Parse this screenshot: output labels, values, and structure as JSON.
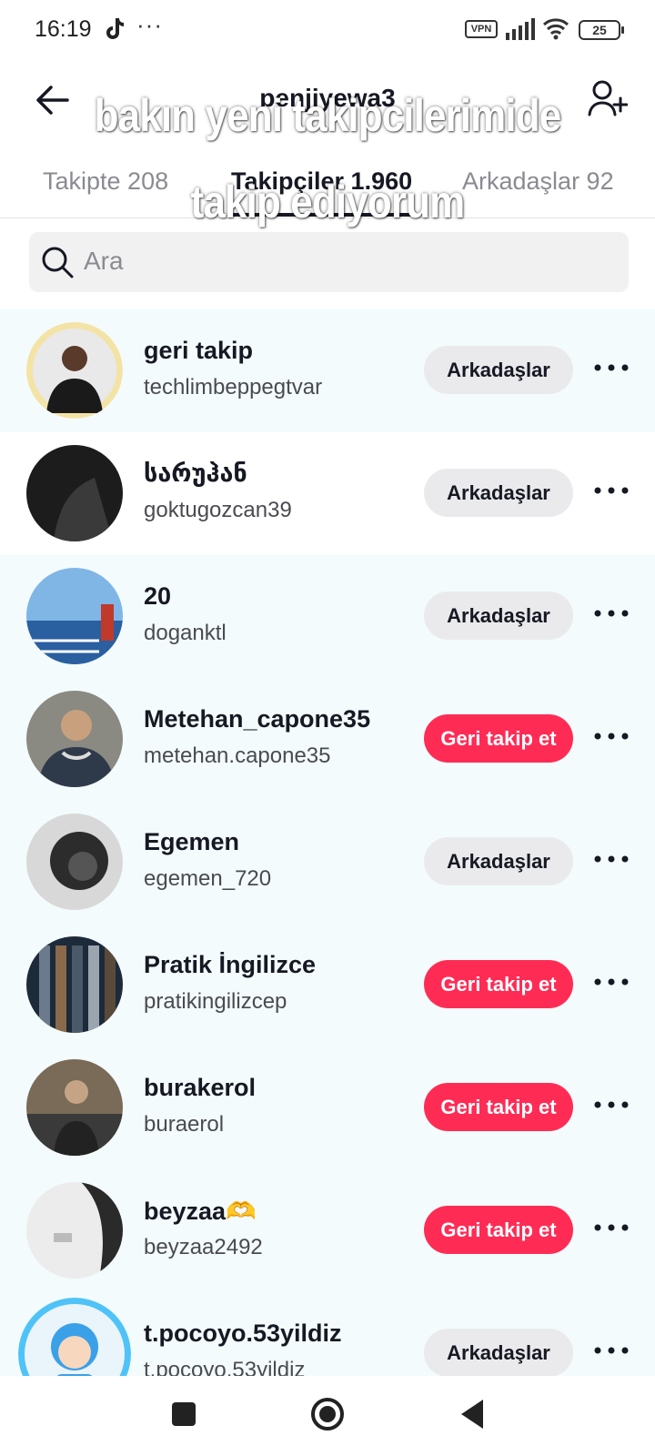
{
  "status_bar": {
    "time": "16:19",
    "dots": "···",
    "vpn": "VPN",
    "battery": "25"
  },
  "header": {
    "username": "penjiyewa3"
  },
  "overlay_caption": {
    "line1": "bakın yeni takipcilerimide",
    "line2": "takip ediyorum"
  },
  "tabs": {
    "following": "Takipte 208",
    "followers": "Takipçiler 1.960",
    "friends": "Arkadaşlar 92"
  },
  "search": {
    "placeholder": "Ara"
  },
  "colors": {
    "accent": "#fe2c55",
    "friends_button_bg": "#eaeaec",
    "list_bg": "#f3fbfc"
  },
  "followers": [
    {
      "name": "geri takip",
      "handle": "techlimbeppegtvar",
      "button": "Arkadaşlar",
      "button_type": "friends"
    },
    {
      "name": "სარუჰან",
      "handle": "goktugozcan39",
      "button": "Arkadaşlar",
      "button_type": "friends"
    },
    {
      "name": "20",
      "handle": "doganktl",
      "button": "Arkadaşlar",
      "button_type": "friends"
    },
    {
      "name": "Metehan_capone35",
      "handle": "metehan.capone35",
      "button": "Geri takip et",
      "button_type": "followback"
    },
    {
      "name": "Egemen",
      "handle": "egemen_720",
      "button": "Arkadaşlar",
      "button_type": "friends"
    },
    {
      "name": "Pratik İngilizce",
      "handle": "pratikingilizcep",
      "button": "Geri takip et",
      "button_type": "followback"
    },
    {
      "name": "burakerol",
      "handle": "buraerol",
      "button": "Geri takip et",
      "button_type": "followback"
    },
    {
      "name": "beyzaa🫶",
      "handle": "beyzaa2492",
      "button": "Geri takip et",
      "button_type": "followback"
    },
    {
      "name": "t.pocoyo.53yildiz",
      "handle": "t.pocoyo.53yildiz",
      "button": "Arkadaşlar",
      "button_type": "friends"
    }
  ],
  "icons": {
    "back": "arrow-left-icon",
    "add_user": "add-user-icon",
    "search": "search-icon",
    "more": "more-horizontal-icon",
    "nav_recents": "square-icon",
    "nav_home": "circle-home-icon",
    "nav_back": "triangle-back-icon"
  }
}
